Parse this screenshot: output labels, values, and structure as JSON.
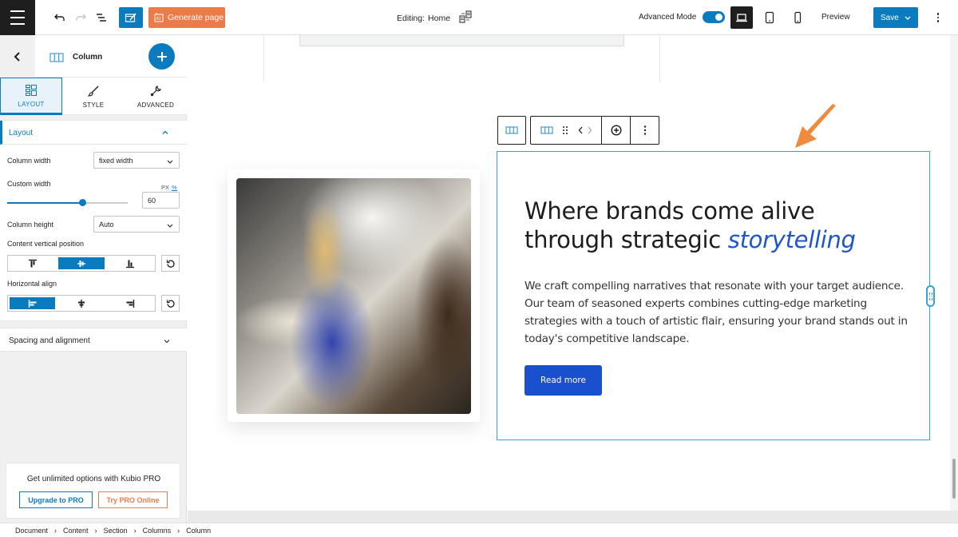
{
  "topbar": {
    "generate_label": "Generate page",
    "editing_prefix": "Editing:",
    "editing_page": "Home",
    "advanced_mode_label": "Advanced Mode",
    "advanced_mode_on": true,
    "active_device": "desktop",
    "preview_label": "Preview",
    "save_label": "Save"
  },
  "sidebar": {
    "block_name": "Column",
    "tabs": [
      {
        "label": "LAYOUT",
        "active": true
      },
      {
        "label": "STYLE",
        "active": false
      },
      {
        "label": "ADVANCED",
        "active": false
      }
    ],
    "layout_panel": {
      "title": "Layout",
      "column_width_label": "Column width",
      "column_width_value": "fixed width",
      "custom_width_label": "Custom width",
      "unit_px": "PX",
      "unit_pct": "%",
      "custom_width_value": "60",
      "custom_width_fraction": 0.62,
      "column_height_label": "Column height",
      "column_height_value": "Auto",
      "vertical_position_label": "Content vertical position",
      "vertical_position_selected": "middle",
      "horizontal_align_label": "Horizontal align",
      "horizontal_align_selected": "left"
    },
    "spacing_panel_title": "Spacing and alignment",
    "promo": {
      "text": "Get unlimited options with Kubio PRO",
      "upgrade_label": "Upgrade to PRO",
      "try_label": "Try PRO Online"
    }
  },
  "canvas": {
    "headline_main": "Where brands come alive through strategic ",
    "headline_accent": "storytelling",
    "body": "We craft compelling narratives that resonate with your target audience. Our team of seasoned experts combines cutting-edge marketing strategies with a touch of artistic flair, ensuring your brand stands out in today's competitive landscape.",
    "button_label": "Read more"
  },
  "colors": {
    "brand_blue": "#0a7bbf",
    "accent_orange": "#ec7b4a",
    "headline_accent": "#1e56c8",
    "button_blue": "#1a4fce",
    "selection_border": "#3b9fd9"
  },
  "breadcrumb": [
    "Document",
    "Content",
    "Section",
    "Columns",
    "Column"
  ]
}
